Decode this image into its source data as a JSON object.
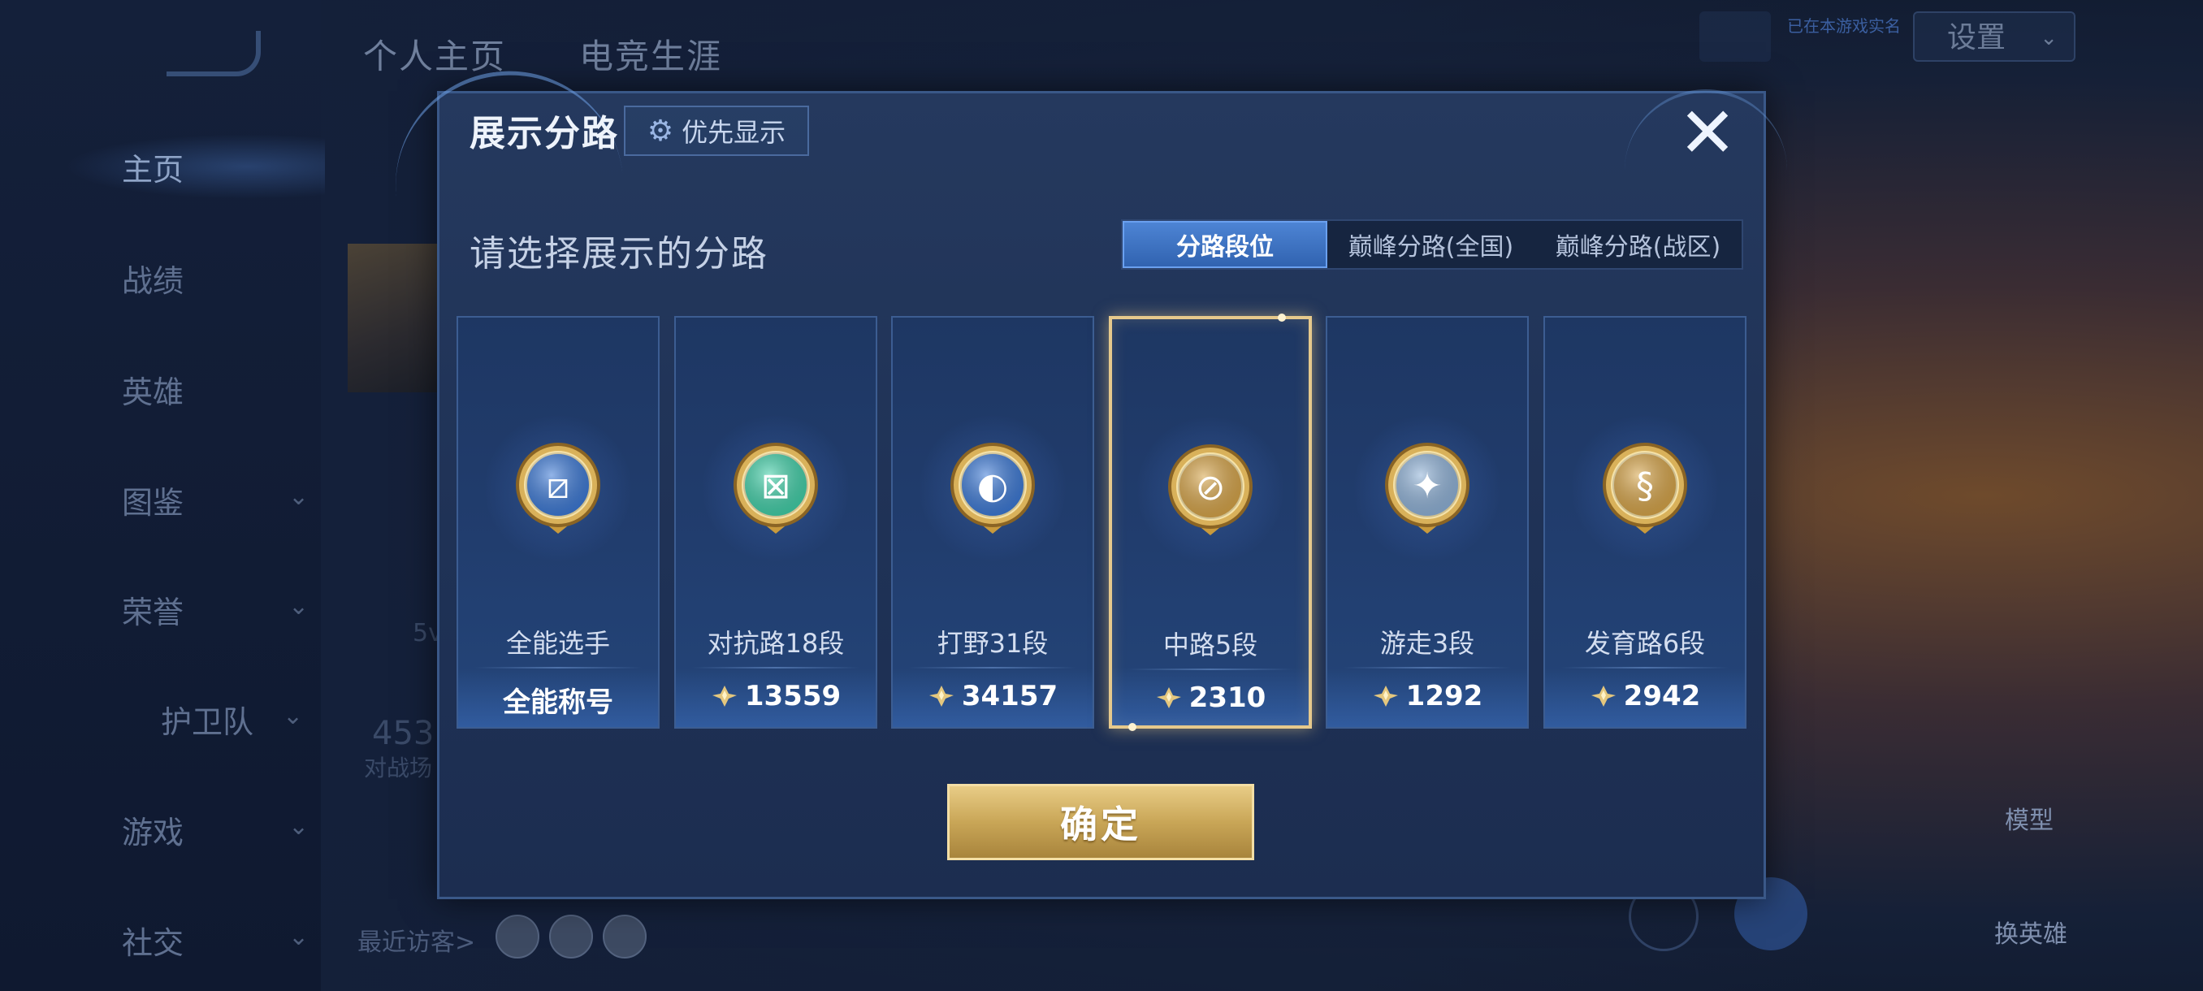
{
  "background": {
    "top_tabs": [
      "个人主页",
      "电竞生涯"
    ],
    "settings_label": "设置",
    "verified_tag": "已在本游戏实名",
    "sidebar": [
      {
        "label": "主页",
        "active": true,
        "chevron": false
      },
      {
        "label": "战绩",
        "active": false,
        "chevron": false
      },
      {
        "label": "英雄",
        "active": false,
        "chevron": false
      },
      {
        "label": "图鉴",
        "active": false,
        "chevron": true
      },
      {
        "label": "荣誉",
        "active": false,
        "chevron": true
      },
      {
        "label": "护卫队",
        "active": false,
        "chevron": true
      },
      {
        "label": "游戏",
        "active": false,
        "chevron": true
      },
      {
        "label": "社交",
        "active": false,
        "chevron": true
      }
    ],
    "partial_texts": {
      "sv": "5v",
      "num": "453",
      "battle": "对战场"
    },
    "recent_visitors_label": "最近访客>",
    "model_label": "模型",
    "swap_hero_label": "换英雄"
  },
  "dialog": {
    "title": "展示分路",
    "priority_button": "优先显示",
    "subtitle": "请选择展示的分路",
    "tabs": [
      {
        "label": "分路段位",
        "active": true
      },
      {
        "label": "巅峰分路(全国)",
        "active": false
      },
      {
        "label": "巅峰分路(战区)",
        "active": false
      }
    ],
    "cards": [
      {
        "name": "全能选手",
        "value": "全能称号",
        "show_icon": false,
        "selected": false,
        "badge": "all-round-badge-icon",
        "color": "#3a78d6"
      },
      {
        "name": "对抗路18段",
        "value": "13559",
        "show_icon": true,
        "selected": false,
        "badge": "clash-lane-badge-icon",
        "color": "#3fd0a8"
      },
      {
        "name": "打野31段",
        "value": "34157",
        "show_icon": true,
        "selected": false,
        "badge": "jungle-badge-icon",
        "color": "#3a78d6"
      },
      {
        "name": "中路5段",
        "value": "2310",
        "show_icon": true,
        "selected": true,
        "badge": "mid-lane-badge-icon",
        "color": "#d7a447"
      },
      {
        "name": "游走3段",
        "value": "1292",
        "show_icon": true,
        "selected": false,
        "badge": "roam-badge-icon",
        "color": "#8fb2d8"
      },
      {
        "name": "发育路6段",
        "value": "2942",
        "show_icon": true,
        "selected": false,
        "badge": "farm-lane-badge-icon",
        "color": "#d7a447"
      }
    ],
    "confirm_button": "确定"
  }
}
